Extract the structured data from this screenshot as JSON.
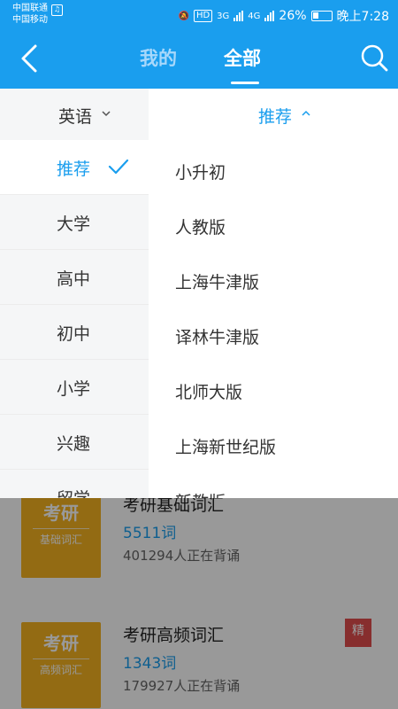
{
  "status_bar": {
    "carrier1": "中国联通",
    "carrier2": "中国移动",
    "hd": "HD",
    "net1": "3G",
    "net2": "4G",
    "battery": "26%",
    "time": "晚上7:28"
  },
  "header": {
    "tab_mine": "我的",
    "tab_all": "全部"
  },
  "filters": {
    "subject": "英语",
    "sort": "推荐"
  },
  "categories": [
    {
      "label": "推荐",
      "active": true
    },
    {
      "label": "大学"
    },
    {
      "label": "高中"
    },
    {
      "label": "初中"
    },
    {
      "label": "小学"
    },
    {
      "label": "兴趣"
    },
    {
      "label": "留学"
    }
  ],
  "options": [
    "小升初",
    "人教版",
    "上海牛津版",
    "译林牛津版",
    "北师大版",
    "上海新世纪版",
    "新教版"
  ],
  "books": [
    {
      "cover_title": "考研",
      "cover_sub": "基础词汇",
      "title": "考研基础词汇",
      "count": "5511词",
      "learners": "401294人正在背诵"
    },
    {
      "cover_title": "考研",
      "cover_sub": "高频词汇",
      "title": "考研高频词汇",
      "count": "1343词",
      "learners": "179927人正在背诵",
      "badge": "精"
    }
  ],
  "colors": {
    "accent": "#1a9eee",
    "cover": "#f5b320",
    "badge": "#e24d4d"
  },
  "icons": [
    "back-icon",
    "search-icon",
    "check-icon",
    "chevron-down-icon",
    "chevron-up-icon"
  ]
}
